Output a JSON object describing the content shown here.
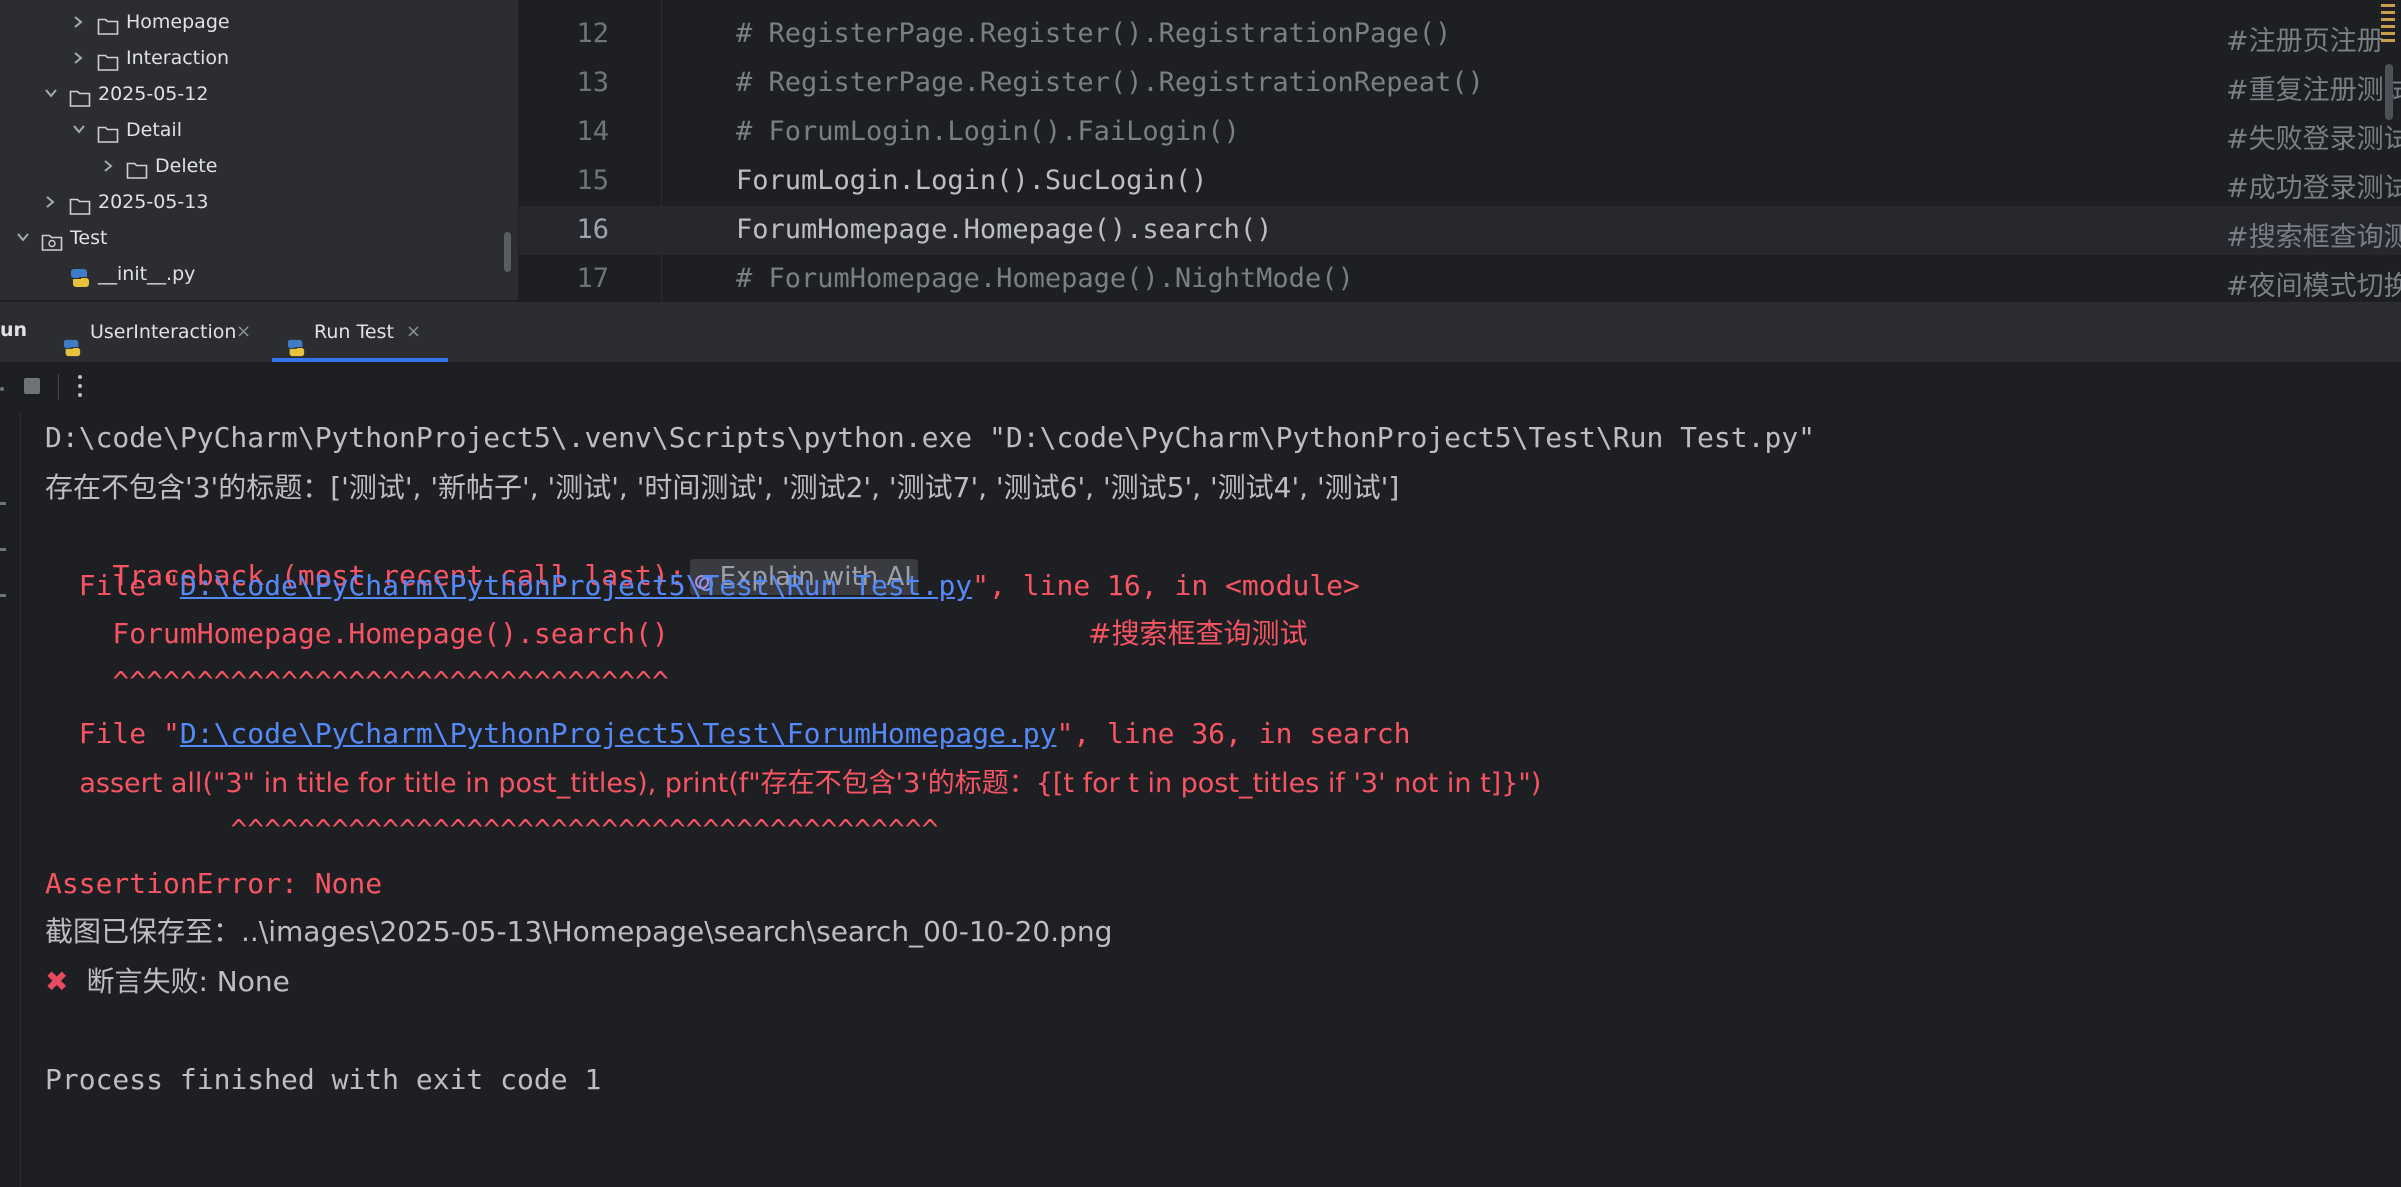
{
  "project_tree": {
    "items": [
      {
        "label": "Homepage",
        "expanded": false,
        "type": "folder"
      },
      {
        "label": "Interaction",
        "expanded": false,
        "type": "folder"
      },
      {
        "label": "2025-05-12",
        "expanded": true,
        "type": "folder"
      },
      {
        "label": "Detail",
        "expanded": true,
        "type": "folder"
      },
      {
        "label": "Delete",
        "expanded": false,
        "type": "folder"
      },
      {
        "label": "2025-05-13",
        "expanded": false,
        "type": "folder"
      },
      {
        "label": "Test",
        "expanded": true,
        "type": "package"
      },
      {
        "label": "__init__.py",
        "type": "python-file"
      }
    ]
  },
  "editor": {
    "lines": [
      {
        "number": "12",
        "code": "# RegisterPage.Register().RegistrationPage()",
        "comment": "#注册页注册",
        "commented_out": true
      },
      {
        "number": "13",
        "code": "# RegisterPage.Register().RegistrationRepeat()",
        "comment": "#重复注册测试",
        "commented_out": true
      },
      {
        "number": "14",
        "code": "# ForumLogin.Login().FaiLogin()",
        "comment": "#失败登录测试",
        "commented_out": true
      },
      {
        "number": "15",
        "code": "ForumLogin.Login().SucLogin()",
        "comment": "#成功登录测试",
        "commented_out": false
      },
      {
        "number": "16",
        "code": "ForumHomepage.Homepage().search()",
        "comment": "#搜索框查询测试",
        "commented_out": false,
        "current": true
      },
      {
        "number": "17",
        "code": "# ForumHomepage.Homepage().NightMode()",
        "comment": "#夜间模式切换测试",
        "commented_out": true
      }
    ]
  },
  "run_panel": {
    "title": "un",
    "tabs": [
      {
        "label": "UserInteraction",
        "active": false
      },
      {
        "label": "Run Test",
        "active": true
      }
    ],
    "close_glyph": "×"
  },
  "console": {
    "command": "D:\\code\\PyCharm\\PythonProject5\\.venv\\Scripts\\python.exe \"D:\\code\\PyCharm\\PythonProject5\\Test\\Run Test.py\"",
    "stdout_titles": "存在不包含'3'的标题：['测试', '新帖子', '测试', '时间测试', '测试2', '测试7', '测试6', '测试5', '测试4', '测试']",
    "traceback_header": "Traceback (most recent call last):",
    "explain_ai": "Explain with AI",
    "frame1_prefix": "  File \"",
    "frame1_path": "D:\\code\\PyCharm\\PythonProject5\\Test\\Run Test.py",
    "frame1_suffix": "\", line 16, in <module>",
    "frame1_code": "    ForumHomepage.Homepage().search()",
    "frame1_comment": "#搜索框查询测试",
    "frame1_carets": "    ^^^^^^^^^^^^^^^^^^^^^^^^^^^^^^^^^",
    "frame2_prefix": "  File \"",
    "frame2_path": "D:\\code\\PyCharm\\PythonProject5\\Test\\ForumHomepage.py",
    "frame2_suffix": "\", line 36, in search",
    "frame2_code": "    assert all(\"3\" in title for title in post_titles), print(f\"存在不包含'3'的标题：{[t for t in post_titles if '3' not in t]}\")",
    "frame2_carets": "           ^^^^^^^^^^^^^^^^^^^^^^^^^^^^^^^^^^^^^^^^^^",
    "error": "AssertionError: None",
    "screenshot_saved": "截图已保存至：..\\images\\2025-05-13\\Homepage\\search\\search_00-10-20.png",
    "fail_icon": "✖",
    "fail_message": "断言失败: None",
    "exit": "Process finished with exit code 1"
  },
  "colors": {
    "background": "#1e1f22",
    "panel": "#2b2d30",
    "error": "#f75464",
    "link": "#548af7",
    "accent": "#3574f0",
    "comment": "#7a7e85"
  }
}
